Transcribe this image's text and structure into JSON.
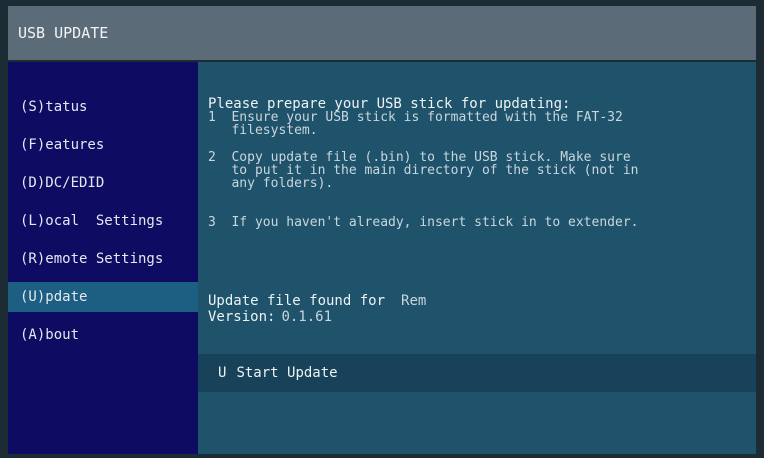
{
  "window": {
    "title": "USB UPDATE"
  },
  "sidebar": {
    "items": [
      {
        "label": "(S)tatus"
      },
      {
        "label": "(F)eatures"
      },
      {
        "label": "(D)DC/EDID"
      },
      {
        "label": "(L)ocal  Settings"
      },
      {
        "label": "(R)emote Settings"
      },
      {
        "label": "(U)pdate",
        "active": true
      },
      {
        "label": "(A)bout"
      }
    ]
  },
  "main": {
    "instructions_title": "Please prepare your USB stick for updating:",
    "steps": [
      {
        "num": "1",
        "text": "Ensure your USB stick is formatted with the FAT-32"
      },
      {
        "num": "",
        "text": "filesystem."
      },
      {
        "num": "2",
        "text": "Copy update file (.bin) to the USB stick. Make sure"
      },
      {
        "num": "",
        "text": "to put it in the main directory of the stick (not in"
      },
      {
        "num": "",
        "text": "any folders)."
      },
      {
        "num": "3",
        "text": "If you haven't already, insert stick in to extender."
      }
    ],
    "update_found_label": "Update file found for",
    "update_found_target": "Rem",
    "version_label": "Version:",
    "version_value": "0.1.61",
    "action": {
      "key": "U",
      "label": "Start Update"
    }
  },
  "colors": {
    "titlebar": "#5b6b78",
    "sidebar": "#0d0b62",
    "sidebar_active": "#1c5f82",
    "content": "#1f536b",
    "action_bar": "#17425a"
  }
}
